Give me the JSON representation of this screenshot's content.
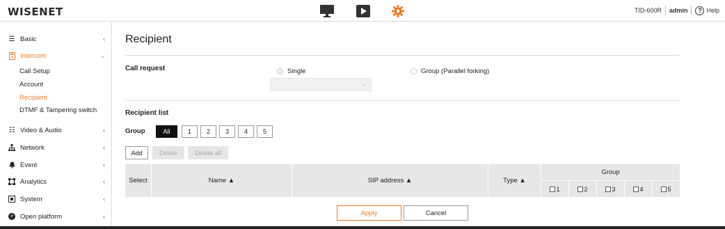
{
  "header": {
    "logo": "WISENET",
    "device": "TID-600R",
    "user": "admin",
    "help": "Help",
    "accent": "#f07a22",
    "icons": [
      "monitor-icon",
      "play-icon",
      "gear-icon"
    ]
  },
  "sidebar": {
    "items": [
      {
        "label": "Basic",
        "icon": "list-icon",
        "chev": "‹"
      },
      {
        "label": "Intercom",
        "icon": "intercom-icon",
        "chev": "⌄"
      },
      {
        "label": "Video & Audio",
        "icon": "sliders-icon",
        "chev": "‹"
      },
      {
        "label": "Network",
        "icon": "network-icon",
        "chev": "‹"
      },
      {
        "label": "Event",
        "icon": "bell-icon",
        "chev": "‹"
      },
      {
        "label": "Analytics",
        "icon": "analytics-icon",
        "chev": "‹"
      },
      {
        "label": "System",
        "icon": "system-icon",
        "chev": "‹"
      },
      {
        "label": "Open platform",
        "icon": "platform-icon",
        "chev": "‹"
      }
    ],
    "subitems": [
      "Call Setup",
      "Account",
      "Recipient",
      "DTMF & Tampering switch"
    ]
  },
  "main": {
    "title": "Recipient",
    "call_request": {
      "label": "Call request",
      "single": "Single",
      "group": "Group (Parallel forking)"
    },
    "recipient_list": {
      "label": "Recipient list",
      "group_label": "Group",
      "group_buttons": [
        "All",
        "1",
        "2",
        "3",
        "4",
        "5"
      ],
      "actions": [
        "Add",
        "Delete",
        "Delete all"
      ]
    },
    "table": {
      "select": "Select",
      "name": "Name ▲",
      "sip": "SIP address ▲",
      "type": "Type ▲",
      "group": "Group",
      "group_cols": [
        "1",
        "2",
        "3",
        "4",
        "5"
      ]
    },
    "apply": "Apply",
    "cancel": "Cancel"
  }
}
